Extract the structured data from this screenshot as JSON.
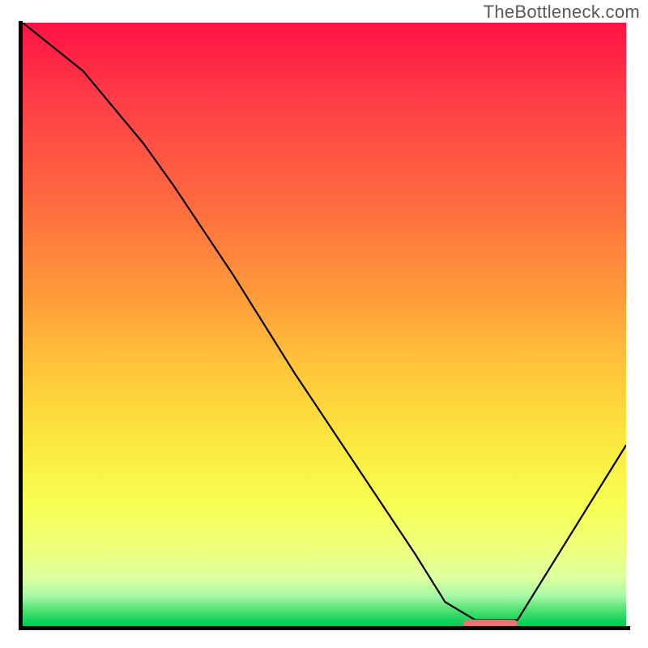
{
  "watermark": "TheBottleneck.com",
  "chart_data": {
    "type": "line",
    "title": "",
    "xlabel": "",
    "ylabel": "",
    "xlim": [
      0,
      100
    ],
    "ylim": [
      0,
      100
    ],
    "grid": false,
    "background": "gradient_red_to_green",
    "series": [
      {
        "name": "bottleneck-curve",
        "x": [
          0,
          10,
          20,
          25,
          35,
          45,
          55,
          65,
          70,
          75,
          82,
          100
        ],
        "y": [
          100,
          92,
          80,
          73,
          58,
          42,
          27,
          12,
          4,
          1,
          1,
          30
        ]
      }
    ],
    "optimal_marker": {
      "x_start": 73,
      "x_end": 82,
      "y": 0.4
    },
    "colors": {
      "curve": "#000000",
      "marker": "#e77373",
      "axes": "#000000"
    }
  }
}
